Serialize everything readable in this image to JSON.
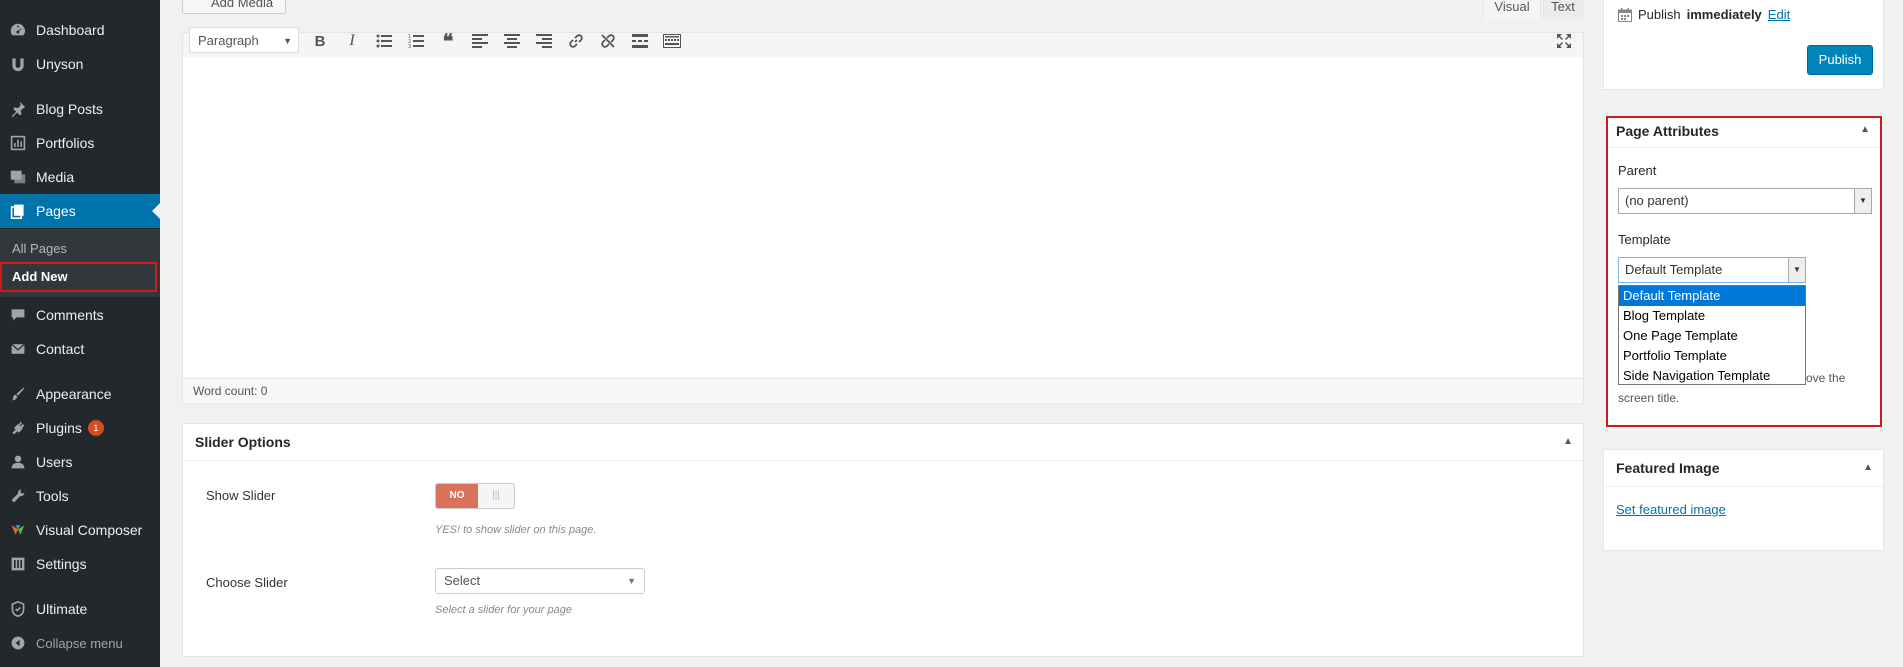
{
  "sidebar": {
    "items": [
      {
        "label": "Dashboard",
        "icon": "dashboard-icon"
      },
      {
        "label": "Unyson",
        "icon": "unyson-icon"
      },
      {
        "label": "Blog Posts",
        "icon": "pin-icon"
      },
      {
        "label": "Portfolios",
        "icon": "portfolio-icon"
      },
      {
        "label": "Media",
        "icon": "media-icon"
      },
      {
        "label": "Pages",
        "icon": "pages-icon"
      },
      {
        "label": "Comments",
        "icon": "comment-icon"
      },
      {
        "label": "Contact",
        "icon": "mail-icon"
      },
      {
        "label": "Appearance",
        "icon": "brush-icon"
      },
      {
        "label": "Plugins",
        "icon": "plugin-icon",
        "badge": "1"
      },
      {
        "label": "Users",
        "icon": "user-icon"
      },
      {
        "label": "Tools",
        "icon": "wrench-icon"
      },
      {
        "label": "Visual Composer",
        "icon": "visual-composer-icon"
      },
      {
        "label": "Settings",
        "icon": "settings-icon"
      },
      {
        "label": "Ultimate",
        "icon": "shield-icon"
      }
    ],
    "submenu": [
      "All Pages",
      "Add New"
    ],
    "collapse_label": "Collapse menu"
  },
  "editor": {
    "add_media_label": "Add Media",
    "tab_visual": "Visual",
    "tab_text": "Text",
    "format_value": "Paragraph",
    "word_count": "Word count: 0"
  },
  "slider_options": {
    "title": "Slider Options",
    "show_slider_label": "Show Slider",
    "show_slider_value": "NO",
    "show_slider_help": "YES! to show slider on this page.",
    "choose_slider_label": "Choose Slider",
    "choose_slider_value": "Select",
    "choose_slider_help": "Select a slider for your page"
  },
  "publish": {
    "publish_prefix": "Publish",
    "publish_when": "immediately",
    "edit_link": "Edit",
    "publish_button": "Publish"
  },
  "page_attributes": {
    "title": "Page Attributes",
    "parent_label": "Parent",
    "parent_value": "(no parent)",
    "template_label": "Template",
    "template_value": "Default Template",
    "template_options": [
      "Default Template",
      "Blog Template",
      "One Page Template",
      "Portfolio Template",
      "Side Navigation Template"
    ],
    "hint_tail": "ove the",
    "hint_second": "screen title."
  },
  "featured_image": {
    "title": "Featured Image",
    "link": "Set featured image"
  },
  "colors": {
    "sidebar_bg": "#23282d",
    "accent": "#0073aa",
    "highlight_outline": "#d11a1a",
    "switch_off": "#d9725b"
  }
}
